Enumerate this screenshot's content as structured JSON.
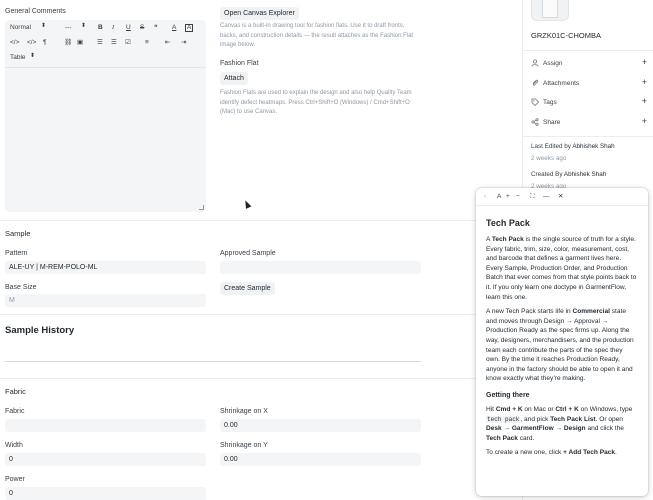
{
  "general_comments": {
    "label": "General Comments",
    "toolbar": {
      "style_select": "Normal",
      "size_select": "---",
      "bold": "B",
      "italic": "I",
      "underline": "U",
      "strike": "S",
      "quote": "❝",
      "font_color": "A",
      "bg_color": "A",
      "code": "</>",
      "direction": "¶",
      "link": "⛓",
      "image": "▣",
      "ordered_list": "☰",
      "bullet_list": "☰",
      "check_list": "☑",
      "align": "≡",
      "outdent": "⇤",
      "indent": "⇥",
      "table_select": "Table"
    }
  },
  "canvas": {
    "button": "Open Canvas Explorer",
    "help": "Canvas is a built-in drawing tool for fashion flats. Use it to draft fronts, backs, and construction details — the result attaches as the Fashion Flat image below."
  },
  "fashion_flat": {
    "label": "Fashion Flat",
    "button": "Attach",
    "help": "Fashion Flats are used to explain the design and also help Quality Team identify defect heatmaps. Press Ctrl+Shift+O (Windows) / Cmd+Shift+O (Mac) to use Canvas."
  },
  "sample": {
    "title": "Sample",
    "pattern_label": "Pattern",
    "pattern_value": "ALE-UY | M-REM-POLO-ML",
    "approved_label": "Approved Sample",
    "approved_value": "",
    "base_size_label": "Base Size",
    "base_size_value": "M",
    "create_button": "Create Sample"
  },
  "sample_history": {
    "title": "Sample History"
  },
  "fabric": {
    "title": "Fabric",
    "fabric_label": "Fabric",
    "fabric_value": "",
    "shrink_x_label": "Shrinkage on X",
    "shrink_x_value": "0.00",
    "width_label": "Width",
    "width_value": "0",
    "shrink_y_label": "Shrinkage on Y",
    "shrink_y_value": "0.00",
    "power_label": "Power",
    "power_value": "0"
  },
  "sidebar": {
    "doc_name": "GRZK01C-CHOMBA",
    "items": [
      {
        "label": "Assign",
        "icon": "user-icon"
      },
      {
        "label": "Attachments",
        "icon": "paperclip-icon"
      },
      {
        "label": "Tags",
        "icon": "tag-icon"
      },
      {
        "label": "Share",
        "icon": "share-icon"
      }
    ],
    "plus": "+",
    "last_edited_prefix": "Last Edited by",
    "last_edited_by": "Abhishek Shah",
    "last_edited_when": "2 weeks ago",
    "created_prefix": "Created By",
    "created_by": "Abhishek Shah",
    "created_when": "2 weeks ago"
  },
  "help_panel": {
    "toolbar": {
      "back": "‹",
      "font": "A",
      "plus": "+",
      "minus": "−",
      "expand": "⛶",
      "minimize": "—",
      "close": "✕"
    },
    "title": "Tech Pack",
    "p1_a": "A ",
    "p1_b": "Tech Pack",
    "p1_c": " is the single source of truth for a style. Every fabric, trim, size, color, measurement, cost, and barcode that defines a garment lives here. Every Sample, Production Order, and Production Batch that ever comes from that style points back to it. If you only learn one doctype in GarmentFlow, learn this one.",
    "p2_a": "A new Tech Pack starts life in ",
    "p2_b": "Commercial",
    "p2_c": " state and moves through Design → Approval → Production Ready as the spec firms up. Along the way, designers, merchandisers, and the production team each contribute the parts of the spec they own. By the time it reaches Production Ready, anyone in the factory should be able to open it and know exactly what they’re making.",
    "h2": "Getting there",
    "p3_a": "Hit ",
    "p3_b": "Cmd + K",
    "p3_c": " on Mac or ",
    "p3_d": "Ctrl + K",
    "p3_e": " on Windows, type ",
    "p3_f": "tech pack",
    "p3_g": ", and pick ",
    "p3_h": "Tech Pack List",
    "p3_i": ". Or open ",
    "p3_j": "Desk → GarmentFlow → Design",
    "p3_k": " and click the ",
    "p3_l": "Tech Pack",
    "p3_m": " card.",
    "p4_a": "To create a new one, click ",
    "p4_b": "+ Add Tech Pack",
    "p4_c": "."
  }
}
